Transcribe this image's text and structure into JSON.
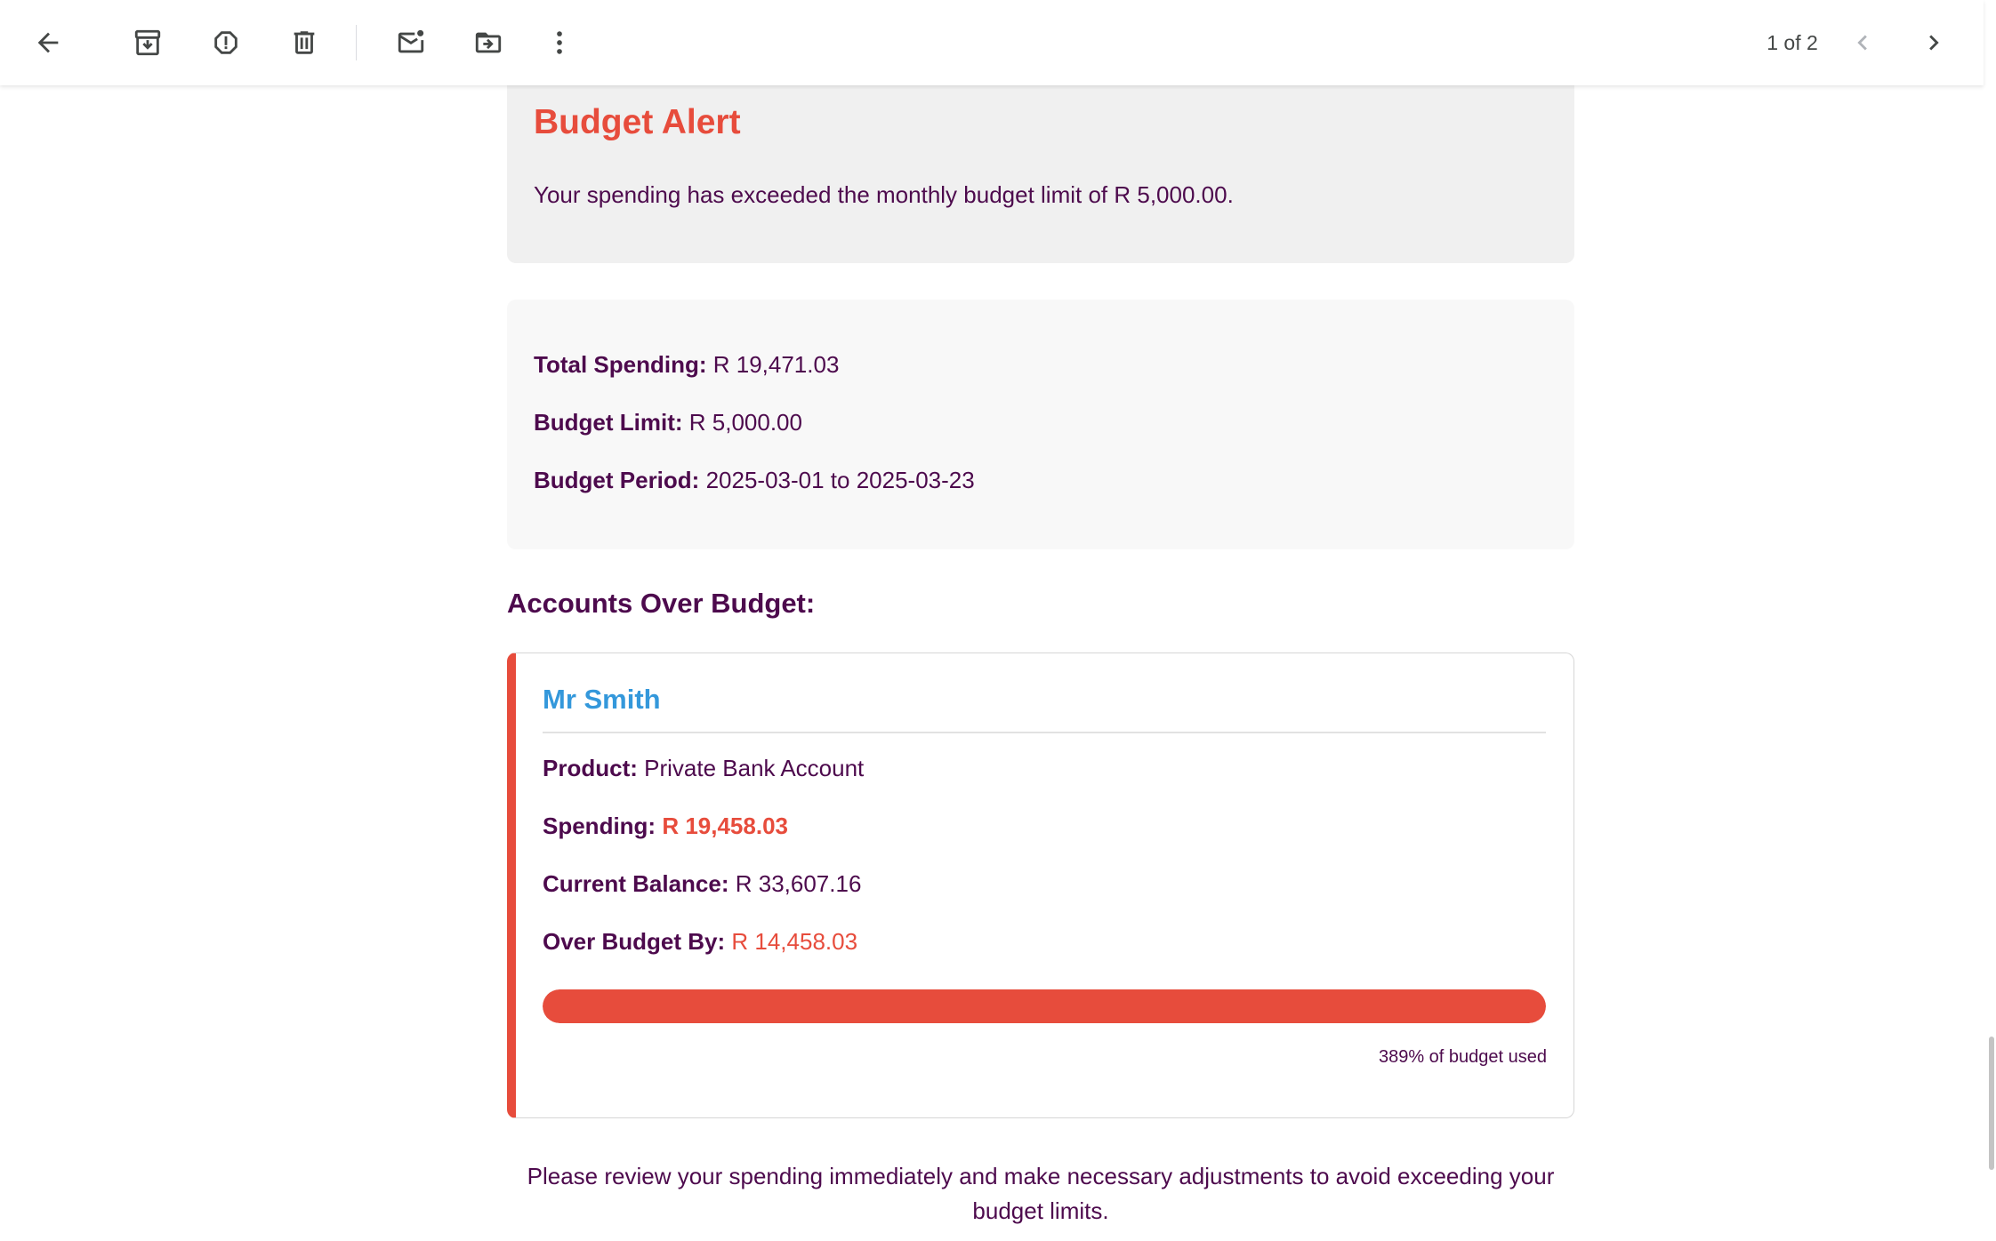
{
  "toolbar": {
    "icons": {
      "back": "arrow-left-icon",
      "archive": "archive-icon",
      "spam": "report-spam-icon",
      "delete": "trash-icon",
      "unread": "mark-unread-icon",
      "move": "move-to-folder-icon",
      "more": "more-vert-icon",
      "prev": "chevron-left-icon",
      "next": "chevron-right-icon"
    },
    "pager_text": "1 of 2"
  },
  "alert": {
    "title": "Budget Alert",
    "message": "Your spending has exceeded the monthly budget limit of R 5,000.00."
  },
  "summary": {
    "total_label": "Total Spending:",
    "total_value": "R 19,471.03",
    "limit_label": "Budget Limit:",
    "limit_value": "R 5,000.00",
    "period_label": "Budget Period:",
    "period_value": "2025-03-01 to 2025-03-23"
  },
  "accounts_heading": "Accounts Over Budget:",
  "account": {
    "name": "Mr Smith",
    "product_label": "Product:",
    "product_value": "Private Bank Account",
    "spending_label": "Spending:",
    "spending_value": "R 19,458.03",
    "balance_label": "Current Balance:",
    "balance_value": "R 33,607.16",
    "over_label": "Over Budget By:",
    "over_value": "R 14,458.03",
    "progress_fraction": 1.0,
    "progress_caption": "389% of budget used"
  },
  "footer_note": "Please review your spending immediately and make necessary adjustments to avoid exceeding your budget limits.",
  "colors": {
    "alert_red": "#e74c3c",
    "text_purple": "#4d0a4d",
    "account_blue": "#3498db"
  }
}
